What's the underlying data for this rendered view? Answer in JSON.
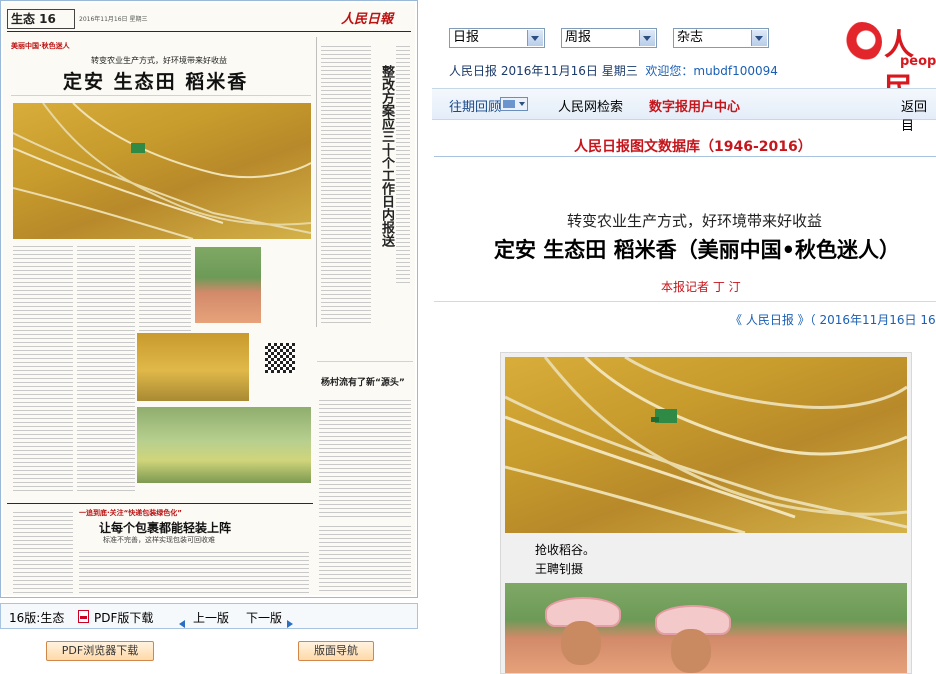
{
  "newspaper": {
    "page_label": "生态 16",
    "masthead_logo": "人民日報",
    "date_line": "2016年11月16日 星期三",
    "column_tag": "美丽中国·秋色迷人",
    "kicker": "转变农业生产方式，好环境带来好收益",
    "headline": "定安 生态田 稻米香",
    "right_column_title": "整改方案应三十个工作日内报送",
    "section_headline_2": "杨村流有了新“源头”",
    "section_tag_bottom": "一追到底·关注“快递包装绿色化”",
    "bottom_headline": "让每个包裹都能轻装上阵",
    "bottom_subhead": "标准不完善，这样实现包装可回收难"
  },
  "pager": {
    "page_name": "16版:生态",
    "pdf_download": "PDF版下载",
    "prev_page": "上一版",
    "next_page": "下一版"
  },
  "buttons": {
    "pdf_browser_download": "PDF浏览器下载",
    "page_navigation": "版面导航"
  },
  "header": {
    "select_daily": "日报",
    "select_weekly": "周报",
    "select_magazine": "杂志",
    "date_line": "人民日报  2016年11月16日  星期三",
    "welcome_label": "欢迎您：",
    "username": "mubdf100094",
    "logo_text": "人民",
    "logo_sub": "peop"
  },
  "nav": {
    "past_review": "往期回顾",
    "search": "人民网检索",
    "digital_user_center": "数字报用户中心",
    "back": "返回目"
  },
  "article": {
    "database_title": "人民日报图文数据库（1946-2016）",
    "subtitle": "转变农业生产方式，好环境带来好收益",
    "title": "定安 生态田 稻米香（美丽中国•秋色迷人）",
    "byline": "本报记者  丁  汀",
    "source_link": "《  人民日报  》（  2016年11月16日    16",
    "caption_line1": "抢收稻谷。",
    "caption_line2": "王聘钊摄"
  },
  "colors": {
    "accent_red": "#c4161c",
    "nav_blue": "#1a4a8a",
    "link_blue": "#1a5fb4",
    "border_blue": "#9ab9d8"
  }
}
